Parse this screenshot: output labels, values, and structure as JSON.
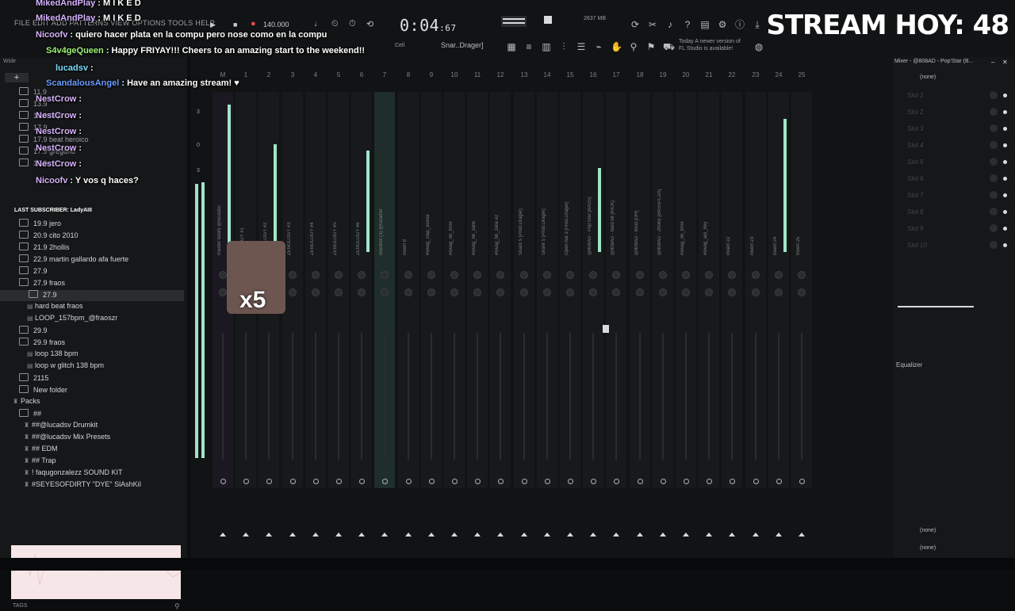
{
  "menu": "FILE  EDIT  ADD  PATTERNS  VIEW  OPTIONS  TOOLS  HELP",
  "transport": {
    "tempo": "140.000",
    "time_main": "0:04",
    "time_small": ":67"
  },
  "cpu": "2637 MB",
  "notice": {
    "line1": "Today  A newer version of",
    "line2": "FL Studio is available!"
  },
  "snap": "Snar..Drager]",
  "cell": "Cell",
  "wide": "Wide",
  "stream_title": "STREAM HOY: 48",
  "chat": [
    {
      "user": "MikedAndPlay",
      "text": ": M I K E D"
    },
    {
      "user": "MikedAndPlay",
      "text": ": M I K E D"
    },
    {
      "user": "Nicoofv",
      "text": ": quiero hacer plata en la compu pero nose como en la compu"
    },
    {
      "user": "S4v4geQueen",
      "text": ": Happy FRIYAY!!! Cheers to an amazing start to the weekend!!"
    },
    {
      "user": "lucadsv",
      "text": ":"
    },
    {
      "user": "ScandalousAngel",
      "text": ": Have an amazing stream! ♥"
    },
    {
      "user": "NestCrow",
      "text": ":"
    },
    {
      "user": "NestCrow",
      "text": ":"
    },
    {
      "user": "NestCrow",
      "text": ":"
    },
    {
      "user": "NestCrow",
      "text": ":"
    },
    {
      "user": "NestCrow",
      "text": ":"
    },
    {
      "user": "Nicoofv",
      "text": ": Y vos q haces?"
    }
  ],
  "last_sub": "LAST SUBSCRIBER: LadyAIII",
  "cam_badge": "x5",
  "browser": [
    {
      "label": "19.9 jero",
      "kind": "folder"
    },
    {
      "label": "20.9 cito 2010",
      "kind": "folder"
    },
    {
      "label": "21.9 2hollis",
      "kind": "folder"
    },
    {
      "label": "22.9 martin gallardo afa fuerte",
      "kind": "folder"
    },
    {
      "label": "27.9",
      "kind": "folder"
    },
    {
      "label": "27.9 fraos",
      "kind": "folder"
    },
    {
      "label": "27.9",
      "kind": "sub",
      "selected": true
    },
    {
      "label": "hard beat fraos",
      "kind": "file"
    },
    {
      "label": "LOOP_157bpm_@fraoszr",
      "kind": "file"
    },
    {
      "label": "29.9",
      "kind": "folder"
    },
    {
      "label": "29.9 fraos",
      "kind": "folder"
    },
    {
      "label": "loop 138 bpm",
      "kind": "file"
    },
    {
      "label": "loop w glitch 138 bpm",
      "kind": "file"
    },
    {
      "label": "2115",
      "kind": "folder"
    },
    {
      "label": "New folder",
      "kind": "folder"
    },
    {
      "label": "Packs",
      "kind": "pack"
    },
    {
      "label": "##",
      "kind": "folder"
    },
    {
      "label": "##@lucadsv Drumkit",
      "kind": "pack"
    },
    {
      "label": "##@lucadsv Mix Presets",
      "kind": "pack"
    },
    {
      "label": "## EDM",
      "kind": "pack"
    },
    {
      "label": "## Trap",
      "kind": "pack"
    },
    {
      "label": "! faqugonzalezz SOUND KIT",
      "kind": "pack"
    },
    {
      "label": "#SEYESOFDIRTY \"DYE\" SlAshKiI",
      "kind": "pack"
    }
  ],
  "browser_top": [
    "11.9",
    "13.9",
    "13.9 faqu",
    "17.9",
    "17.9 beat heroico",
    "17.9 gregorio",
    "19.9"
  ],
  "tags": "TAGS",
  "mixer": {
    "title": "Mixer - @808AD - Pop'Star (B...",
    "channels": [
      "M",
      "1",
      "2",
      "3",
      "4",
      "5",
      "6",
      "7",
      "8",
      "9",
      "10",
      "11",
      "12",
      "13",
      "14",
      "15",
      "16",
      "17",
      "18",
      "19",
      "20",
      "21",
      "22",
      "23",
      "24",
      "25"
    ],
    "insert_labels": [
      "master beats @lucadsv",
      "(BELOGY #1",
      "ZENOLOGY #2",
      "ZENOLOGY #3",
      "ZENOLOGY #4",
      "ZENOLOGY #5",
      "ZENOLOGY #6",
      "oneshot (3) @lucadsv",
      "Insert 8",
      "#swag_clap_acena",
      "#swag_oh_tmnr",
      "#swag_hh_zelle",
      "#swag_hh_zelle #2",
      "Snare 5 [Prod.Drager]",
      "Snare 5 [Prod.Drager]",
      "Open hat 3 [Prod.Drager]",
      "@808AD - Pop'Star [BASS]",
      "@808AD - hard hit [KICK]",
      "@808AD - Beat [OH]",
      "@808AD - 2hollis [BASSPLUX]",
      "#swag_oh_tmnr",
      "#swag_arp_hey",
      "Insert 22",
      "Insert 23",
      "Insert 24",
      "Insert 25"
    ],
    "meter_levels": [
      0.93,
      0.0,
      0.68,
      0.0,
      0.0,
      0.0,
      0.64,
      0.0,
      0.0,
      0.0,
      0.0,
      0.0,
      0.0,
      0.0,
      0.0,
      0.0,
      0.53,
      0.0,
      0.0,
      0.0,
      0.0,
      0.0,
      0.0,
      0.0,
      0.84,
      0.0
    ],
    "scale": [
      "3",
      "0",
      "3"
    ]
  },
  "right_panel": {
    "top_select": "(none)",
    "slots": [
      "Slot 1",
      "Slot 2",
      "Slot 3",
      "Slot 4",
      "Slot 5",
      "Slot 6",
      "Slot 7",
      "Slot 8",
      "Slot 9",
      "Slot 10"
    ],
    "eq_label": "Equalizer",
    "bottom1": "(none)",
    "bottom2": "(none)"
  }
}
